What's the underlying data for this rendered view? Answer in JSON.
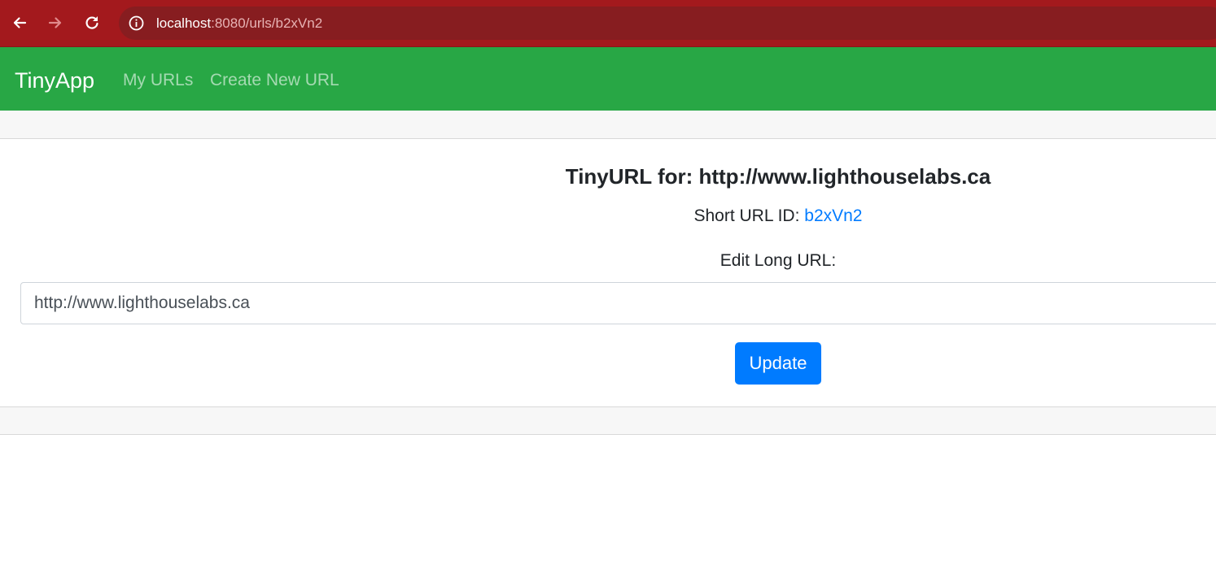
{
  "browser": {
    "url_host": "localhost",
    "url_path": ":8080/urls/b2xVn2",
    "icons": [
      "back-arrow-icon",
      "forward-arrow-icon",
      "reload-icon",
      "info-icon"
    ]
  },
  "navbar": {
    "brand": "TinyApp",
    "links": [
      "My URLs",
      "Create New URL"
    ],
    "background": "#28a745"
  },
  "card": {
    "title": "TinyURL for: http://www.lighthouselabs.ca",
    "short_url_label": "Short URL ID:",
    "short_url_id": "b2xVn2",
    "edit_label": "Edit Long URL:",
    "long_url_value": "http://www.lighthouselabs.ca",
    "update_label": "Update"
  },
  "colors": {
    "browser_chrome": "#a3191d",
    "link": "#007bff",
    "button": "#007bff"
  }
}
